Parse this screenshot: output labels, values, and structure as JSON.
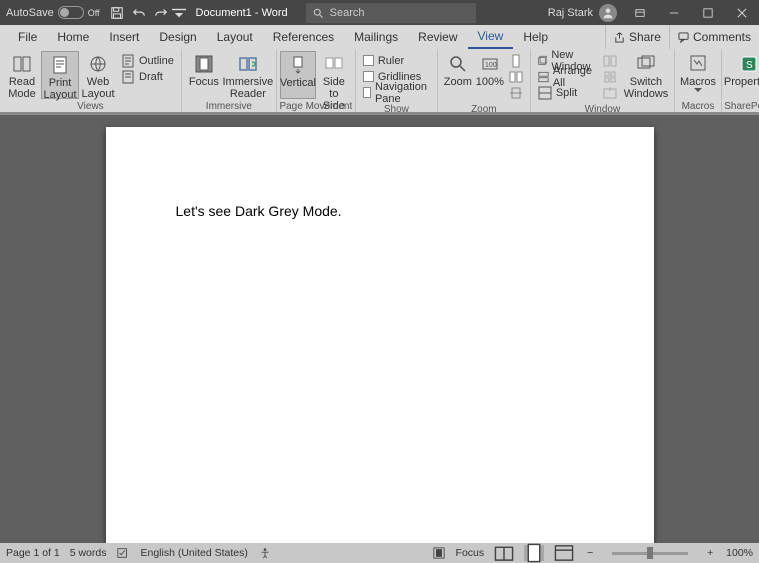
{
  "titlebar": {
    "autosave_label": "AutoSave",
    "autosave_state": "Off",
    "doc_title": "Document1 - Word",
    "search_placeholder": "Search",
    "user_name": "Raj Stark"
  },
  "tabs": {
    "file": "File",
    "home": "Home",
    "insert": "Insert",
    "design": "Design",
    "layout": "Layout",
    "references": "References",
    "mailings": "Mailings",
    "review": "Review",
    "view": "View",
    "help": "Help",
    "share": "Share",
    "comments": "Comments"
  },
  "ribbon": {
    "views": {
      "label": "Views",
      "read_mode": "Read Mode",
      "print_layout": "Print Layout",
      "web_layout": "Web Layout",
      "outline": "Outline",
      "draft": "Draft"
    },
    "immersive": {
      "label": "Immersive",
      "focus": "Focus",
      "immersive_reader": "Immersive Reader"
    },
    "page_movement": {
      "label": "Page Movement",
      "vertical": "Vertical",
      "side": "Side to Side"
    },
    "show": {
      "label": "Show",
      "ruler": "Ruler",
      "gridlines": "Gridlines",
      "nav": "Navigation Pane"
    },
    "zoom": {
      "label": "Zoom",
      "zoom": "Zoom",
      "hundred": "100%"
    },
    "window": {
      "label": "Window",
      "new_window": "New Window",
      "arrange_all": "Arrange All",
      "split": "Split",
      "switch": "Switch Windows"
    },
    "macros": {
      "label": "Macros",
      "macros": "Macros"
    },
    "sharepoint": {
      "label": "SharePoint",
      "properties": "Properties"
    }
  },
  "document": {
    "body": "Let's see Dark Grey Mode."
  },
  "status": {
    "page": "Page 1 of 1",
    "words": "5 words",
    "language": "English (United States)",
    "focus": "Focus",
    "zoom": "100%"
  }
}
